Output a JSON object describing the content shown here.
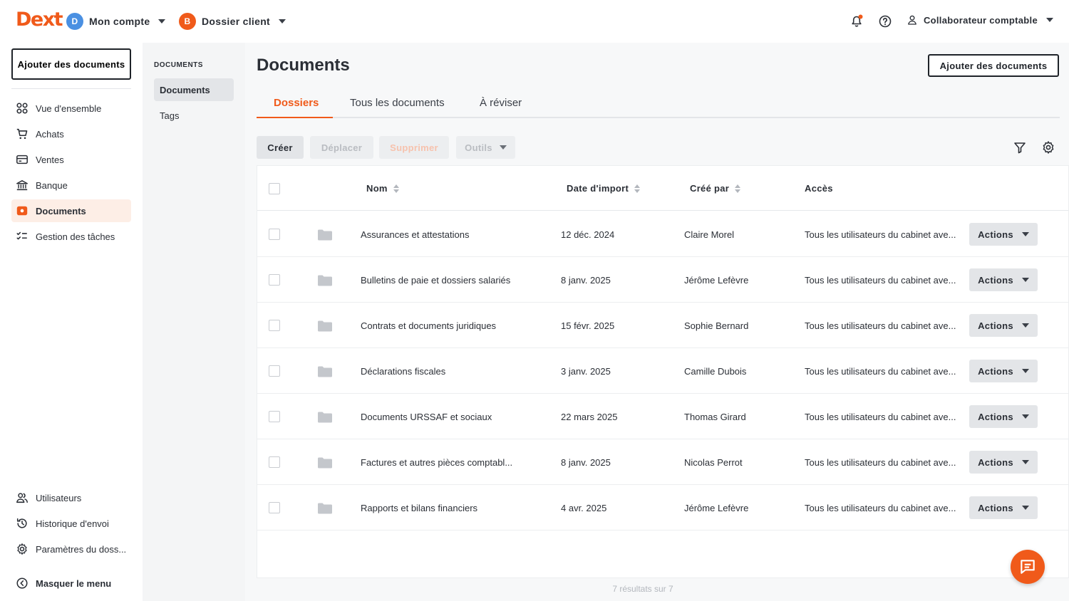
{
  "brand": {
    "logo": "Dext",
    "accent": "#f05a1a"
  },
  "header": {
    "account": {
      "initial": "D",
      "label": "Mon compte",
      "color": "#4a90e2"
    },
    "client": {
      "initial": "B",
      "label": "Dossier client",
      "color": "#f05a1a"
    },
    "icons": [
      "notification-bell-icon",
      "help-icon",
      "user-icon"
    ],
    "user_label": "Collaborateur comptable"
  },
  "leftnav": {
    "add_button": "Ajouter des documents",
    "items": [
      {
        "label": "Vue d'ensemble",
        "icon": "dashboard-icon"
      },
      {
        "label": "Achats",
        "icon": "cart-icon"
      },
      {
        "label": "Ventes",
        "icon": "card-icon"
      },
      {
        "label": "Banque",
        "icon": "bank-icon"
      },
      {
        "label": "Documents",
        "icon": "documents-icon",
        "active": true
      },
      {
        "label": "Gestion des tâches",
        "icon": "tasks-icon"
      }
    ],
    "bottom_items": [
      {
        "label": "Utilisateurs",
        "icon": "users-icon"
      },
      {
        "label": "Historique d'envoi",
        "icon": "history-icon"
      },
      {
        "label": "Paramètres du doss...",
        "icon": "gear-icon"
      }
    ],
    "hide_menu": "Masquer le menu"
  },
  "subnav": {
    "title": "DOCUMENTS",
    "items": [
      {
        "label": "Documents",
        "active": true
      },
      {
        "label": "Tags"
      }
    ]
  },
  "main": {
    "title": "Documents",
    "add_button": "Ajouter des documents",
    "tabs": [
      {
        "label": "Dossiers",
        "active": true
      },
      {
        "label": "Tous les documents"
      },
      {
        "label": "À réviser"
      }
    ],
    "toolbar": {
      "create": "Créer",
      "move": "Déplacer",
      "delete": "Supprimer",
      "tools": "Outils"
    }
  },
  "table": {
    "columns": [
      "Nom",
      "Date d'import",
      "Créé par",
      "Accès"
    ],
    "action_label": "Actions",
    "rows": [
      {
        "name": "Assurances et attestations",
        "date": "12 déc. 2024",
        "author": "Claire Morel",
        "access": "Tous les utilisateurs du cabinet ave..."
      },
      {
        "name": "Bulletins de paie et dossiers salariés",
        "date": "8 janv. 2025",
        "author": "Jérôme Lefèvre",
        "access": "Tous les utilisateurs du cabinet ave..."
      },
      {
        "name": "Contrats et documents juridiques",
        "date": "15 févr. 2025",
        "author": "Sophie Bernard",
        "access": "Tous les utilisateurs du cabinet ave..."
      },
      {
        "name": "Déclarations fiscales",
        "date": "3 janv. 2025",
        "author": "Camille Dubois",
        "access": "Tous les utilisateurs du cabinet ave..."
      },
      {
        "name": "Documents URSSAF et sociaux",
        "date": "22 mars 2025",
        "author": "Thomas Girard",
        "access": "Tous les utilisateurs du cabinet ave..."
      },
      {
        "name": "Factures et autres pièces comptabl...",
        "date": "8 janv. 2025",
        "author": "Nicolas Perrot",
        "access": "Tous les utilisateurs du cabinet ave..."
      },
      {
        "name": "Rapports et bilans financiers",
        "date": "4 avr. 2025",
        "author": "Jérôme Lefèvre",
        "access": "Tous les utilisateurs du cabinet ave..."
      }
    ],
    "results": "7 résultats sur 7"
  }
}
